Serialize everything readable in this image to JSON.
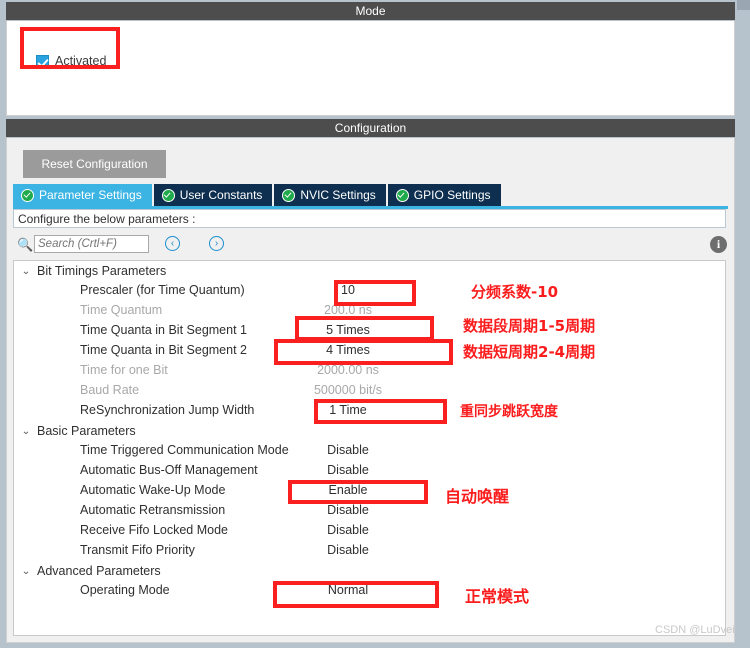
{
  "mode": {
    "header": "Mode",
    "checkbox_label": "Activated",
    "checkbox_checked": true
  },
  "configuration": {
    "header": "Configuration",
    "reset_button": "Reset Configuration",
    "tabs": [
      {
        "label": "Parameter Settings",
        "active": true,
        "icon": "check-circle-icon"
      },
      {
        "label": "User Constants",
        "active": false,
        "icon": "check-circle-icon"
      },
      {
        "label": "NVIC Settings",
        "active": false,
        "icon": "check-circle-icon"
      },
      {
        "label": "GPIO Settings",
        "active": false,
        "icon": "check-circle-icon"
      }
    ],
    "hint": "Configure the below parameters :",
    "search": {
      "placeholder": "Search (Crtl+F)",
      "value": "",
      "icon": "search-icon",
      "prev_icon": "‹",
      "next_icon": "›"
    },
    "info_icon": "i"
  },
  "tree": {
    "caret": "⌄",
    "groups": [
      {
        "label": "Bit Timings Parameters",
        "rows": [
          {
            "name": "Prescaler (for Time Quantum)",
            "value": "10",
            "dim": false
          },
          {
            "name": "Time Quantum",
            "value": "200.0 ns",
            "dim": true
          },
          {
            "name": "Time Quanta in Bit Segment 1",
            "value": "5 Times",
            "dim": false
          },
          {
            "name": "Time Quanta in Bit Segment 2",
            "value": "4 Times",
            "dim": false
          },
          {
            "name": "Time for one Bit",
            "value": "2000.00 ns",
            "dim": true
          },
          {
            "name": "Baud Rate",
            "value": "500000 bit/s",
            "dim": true
          },
          {
            "name": "ReSynchronization Jump Width",
            "value": "1 Time",
            "dim": false
          }
        ]
      },
      {
        "label": "Basic Parameters",
        "rows": [
          {
            "name": "Time Triggered Communication Mode",
            "value": "Disable",
            "dim": false
          },
          {
            "name": "Automatic Bus-Off Management",
            "value": "Disable",
            "dim": false
          },
          {
            "name": "Automatic Wake-Up Mode",
            "value": "Enable",
            "dim": false
          },
          {
            "name": "Automatic Retransmission",
            "value": "Disable",
            "dim": false
          },
          {
            "name": "Receive Fifo Locked Mode",
            "value": "Disable",
            "dim": false
          },
          {
            "name": "Transmit Fifo Priority",
            "value": "Disable",
            "dim": false
          }
        ]
      },
      {
        "label": "Advanced Parameters",
        "rows": [
          {
            "name": "Operating Mode",
            "value": "Normal",
            "dim": false
          }
        ]
      }
    ]
  },
  "annotations": {
    "color": "#fb1d1d",
    "notes": [
      {
        "text": "分频系数-10"
      },
      {
        "text": "数据段周期1-5周期"
      },
      {
        "text": "数据短周期2-4周期"
      },
      {
        "text": "重同步跳跃宽度"
      },
      {
        "text": "自动唤醒"
      },
      {
        "text": "正常模式"
      }
    ]
  },
  "watermark": "CSDN @LuDvei"
}
